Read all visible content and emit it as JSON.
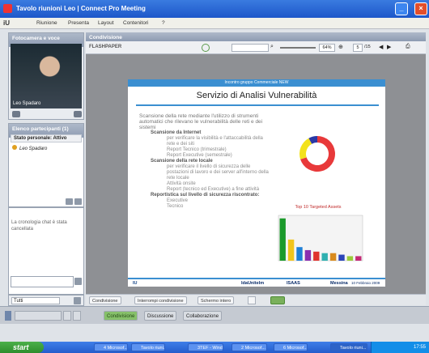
{
  "window": {
    "title": "Tavolo riunioni Leo | Connect Pro Meeting"
  },
  "menu": {
    "items": [
      "Riunione",
      "Presenta",
      "Layout",
      "Contenitori",
      "?"
    ]
  },
  "camera_pod": {
    "title": "Fotocamera e voce",
    "person_name": "Leo Spadaro"
  },
  "people_pod": {
    "title": "Elenco partecipanti (1)",
    "status_label": "Stato personale: Attivo",
    "participants": [
      "Leo Spadaro"
    ]
  },
  "chat_pod": {
    "message": "La cronologia chat è stata cancellata",
    "recipient": "Tutti"
  },
  "share_pod": {
    "title": "Condivisione",
    "brand": "FLASHPAPER",
    "zoom": "64%",
    "page": "5",
    "page_total": "/15"
  },
  "slide": {
    "top_banner": "Incontro gruppo Commerciale NEW",
    "title": "Servizio di Analisi Vulnerabilità",
    "intro": "Scansione della rete mediante l'utilizzo di strumenti automatici che rilevano le vulnerabilità delle reti e dei sistemi",
    "sections": [
      {
        "heading": "Scansione da Internet",
        "items": [
          "per verificare la visibilità e l'attaccabilità della rete e dei siti",
          "Report Tecnico (trimestrale)",
          "Report Executive (semestrale)"
        ]
      },
      {
        "heading": "Scansione della rete locale",
        "items": [
          "per verificare il livello di sicurezza delle postazioni di lavoro e dei server all'interno della rete locale",
          "Attività onsite",
          "Report (tecnico ed Executive) a fine attività"
        ]
      },
      {
        "heading": "Reportistica sul livello di sicurezza riscontrato:",
        "items": [
          "Executive",
          "Tecnico"
        ]
      }
    ],
    "chart_title": "Top 10 Targeted Assets",
    "footer_left": "IdaUnitelm",
    "footer_mid": "ISAAS",
    "footer_right": "Messina",
    "footer_date": "10 Febbraio 2009"
  },
  "chart_data": [
    {
      "type": "pie",
      "title": "",
      "slices": [
        {
          "label": "",
          "value": 70,
          "color": "#e8393a"
        },
        {
          "label": "",
          "value": 22,
          "color": "#f3e21b"
        },
        {
          "label": "",
          "value": 8,
          "color": "#2a39a6"
        }
      ]
    },
    {
      "type": "bar",
      "title": "Top 10 Targeted Assets",
      "categories": [
        "1",
        "2",
        "3",
        "4",
        "5",
        "6",
        "7",
        "8",
        "9",
        "10"
      ],
      "values": [
        28,
        14,
        9,
        7,
        6,
        5,
        5,
        4,
        3,
        3
      ],
      "colors": [
        "#1b9a2b",
        "#f2c51c",
        "#1f7fd6",
        "#8a2db0",
        "#e0342f",
        "#2fb0b0",
        "#d98b1e",
        "#2b45b8",
        "#9acb3a",
        "#c42a75"
      ]
    }
  ],
  "share_controls": {
    "buttons": [
      "Condivisione",
      "Interrompi condivisione",
      "Schermo intero"
    ]
  },
  "layout_bar": {
    "tabs": [
      "Condivisione",
      "Discussione",
      "Collaborazione"
    ]
  },
  "taskbar": {
    "start": "start",
    "tasks": [
      "4 Microsof...",
      "Tavolo riuni...",
      "3TEF - Wind...",
      "2 Microsof...",
      "6 Microsof...",
      "Tavolo riuni..."
    ],
    "clock": "17:55"
  }
}
